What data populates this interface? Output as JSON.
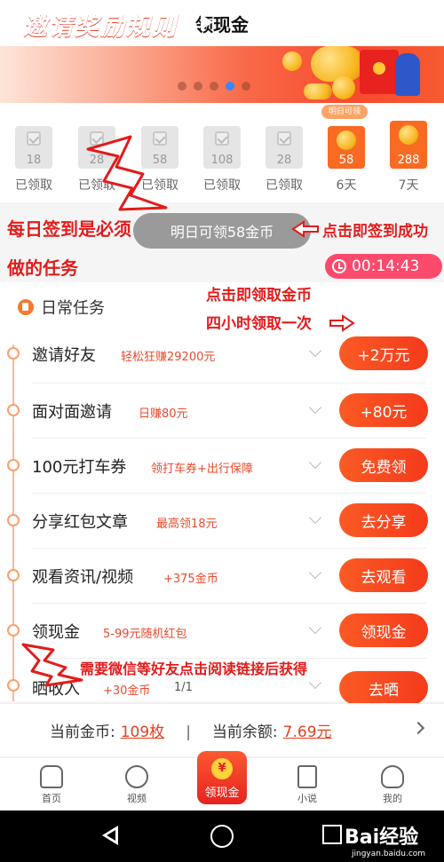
{
  "header": {
    "title": "领现金"
  },
  "banner": {
    "title": "邀请奖励规则",
    "dots": 5,
    "active_dot": 3
  },
  "checkin": {
    "tomorrow_badge": "明日可领",
    "days": [
      {
        "coins": "18",
        "label": "已领取",
        "state": "claimed"
      },
      {
        "coins": "28",
        "label": "已领取",
        "state": "claimed"
      },
      {
        "coins": "58",
        "label": "已领取",
        "state": "claimed"
      },
      {
        "coins": "108",
        "label": "已领取",
        "state": "claimed"
      },
      {
        "coins": "28",
        "label": "已领取",
        "state": "claimed"
      },
      {
        "coins": "58",
        "label": "6天",
        "state": "next"
      },
      {
        "coins": "288",
        "label": "7天",
        "state": "future"
      }
    ],
    "toast": "明日可领58金币"
  },
  "annotations": {
    "daily_a": "每日签到是必须",
    "daily_b": "做的任务",
    "click_signin": "点击即签到成功",
    "chest_a": "点击即领取金币",
    "chest_b": "四小时领取一次",
    "wechat": "需要微信等好友点击阅读链接后获得"
  },
  "timer": {
    "value": "00:14:43"
  },
  "daily_tasks": {
    "title": "日常任务",
    "items": [
      {
        "name": "邀请好友",
        "desc": "轻松狂赚29200元",
        "button": "+2万元"
      },
      {
        "name": "面对面邀请",
        "desc": "日赚80元",
        "button": "+80元"
      },
      {
        "name": "100元打车券",
        "desc": "领打车券+出行保障",
        "button": "免费领"
      },
      {
        "name": "分享红包文章",
        "desc": "最高领18元",
        "button": "去分享"
      },
      {
        "name": "观看资讯/视频",
        "desc": "+375金币",
        "button": "去观看"
      },
      {
        "name": "领现金",
        "desc": "5-99元随机红包",
        "button": "领现金"
      },
      {
        "name": "晒收入",
        "desc": "+30金币",
        "progress": "1/1",
        "button": "去晒"
      }
    ]
  },
  "balance": {
    "coins_label": "当前金币:",
    "coins_value": "109枚",
    "sep": "|",
    "money_label": "当前余额:",
    "money_value": "7.69元"
  },
  "tabbar": {
    "home": "首页",
    "video": "视频",
    "center": "领现金",
    "center_symbol": "¥",
    "novel": "小说",
    "mine": "我的"
  },
  "watermark": {
    "brand": "Bai",
    "suffix": "经验",
    "url": "jingyan.baidu.com"
  },
  "colors": {
    "accent": "#f84a2f",
    "annotation": "#e31b1b",
    "timer": "#fd4a6c"
  }
}
